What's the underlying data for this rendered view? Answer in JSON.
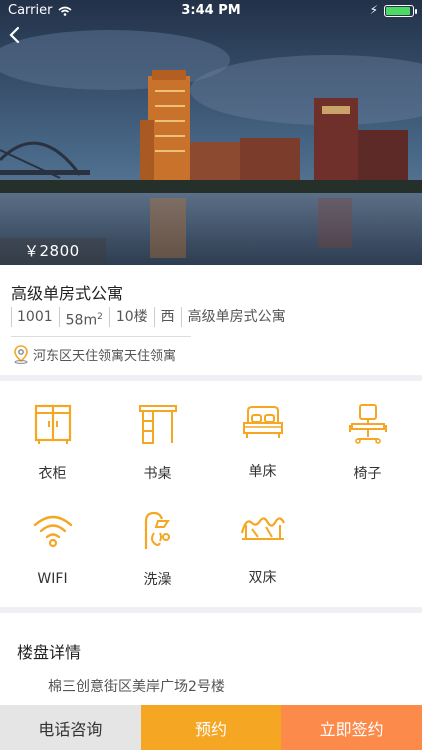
{
  "status_bar": {
    "carrier": "Carrier",
    "time": "3:44 PM"
  },
  "hero": {
    "price": "￥2800"
  },
  "listing": {
    "title": "高级单房式公寓",
    "tags": [
      "1001",
      "58m",
      "10楼",
      "西",
      "高级单房式公寓"
    ],
    "area_unit_sup": "2",
    "address": "河东区天住领寓天住领寓"
  },
  "amenities": [
    {
      "label": "衣柜",
      "icon": "wardrobe-icon"
    },
    {
      "label": "书桌",
      "icon": "desk-icon"
    },
    {
      "label": "单床",
      "icon": "single-bed-icon"
    },
    {
      "label": "椅子",
      "icon": "chair-icon"
    },
    {
      "label": "WIFI",
      "icon": "wifi-icon"
    },
    {
      "label": "洗澡",
      "icon": "shower-icon"
    },
    {
      "label": "双床",
      "icon": "double-bed-icon"
    }
  ],
  "details": {
    "heading": "楼盘详情",
    "address": "棉三创意街区美岸广场2号楼"
  },
  "bottom_bar": {
    "call": "电话咨询",
    "book": "预约",
    "sign": "立即签约"
  },
  "colors": {
    "accent": "#f5a623",
    "sign": "#fb8a4b",
    "call_bg": "#e5e5e5"
  }
}
